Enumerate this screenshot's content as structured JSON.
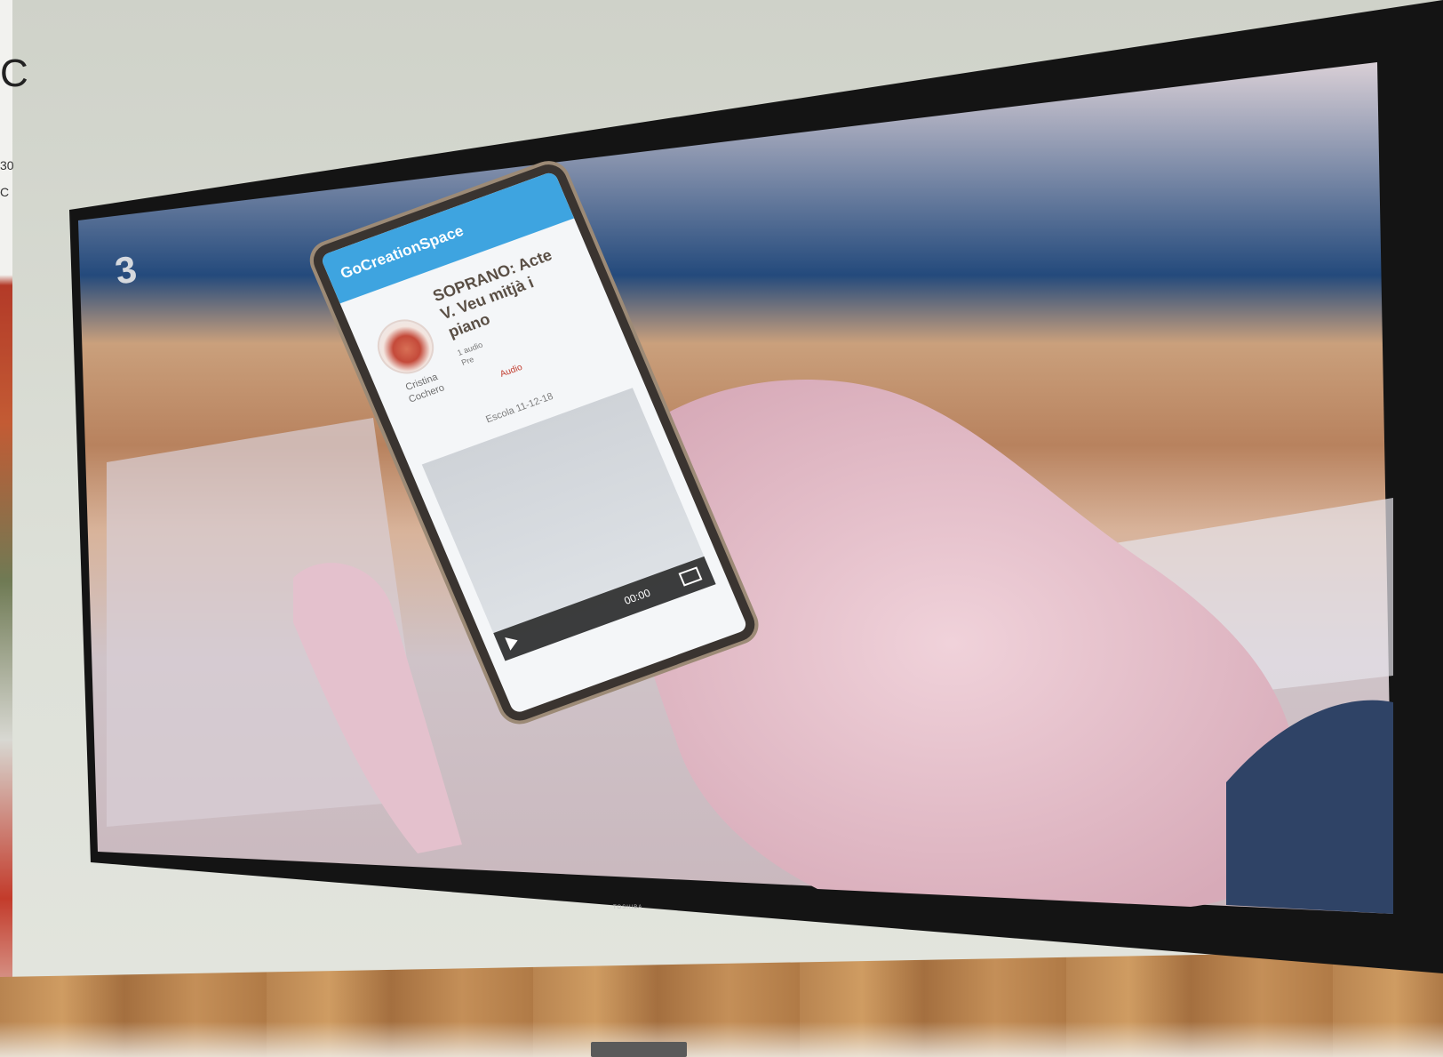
{
  "photo": {
    "edge_letters": [
      "C",
      "30",
      "C"
    ],
    "tv": {
      "channel_logo": "3",
      "brand_text": "TOSHIBA"
    },
    "phone_app": {
      "app_title": "GoCreationSpace",
      "post_title": "SOPRANO: Acte V. Veu mitjà i piano",
      "meta_line1": "1 audio",
      "meta_line2": "Pre",
      "meta_link": "Audio",
      "author_name": "Cristina Cochero",
      "date_text": "Escola 11-12-18",
      "video_time": "00:00"
    }
  }
}
